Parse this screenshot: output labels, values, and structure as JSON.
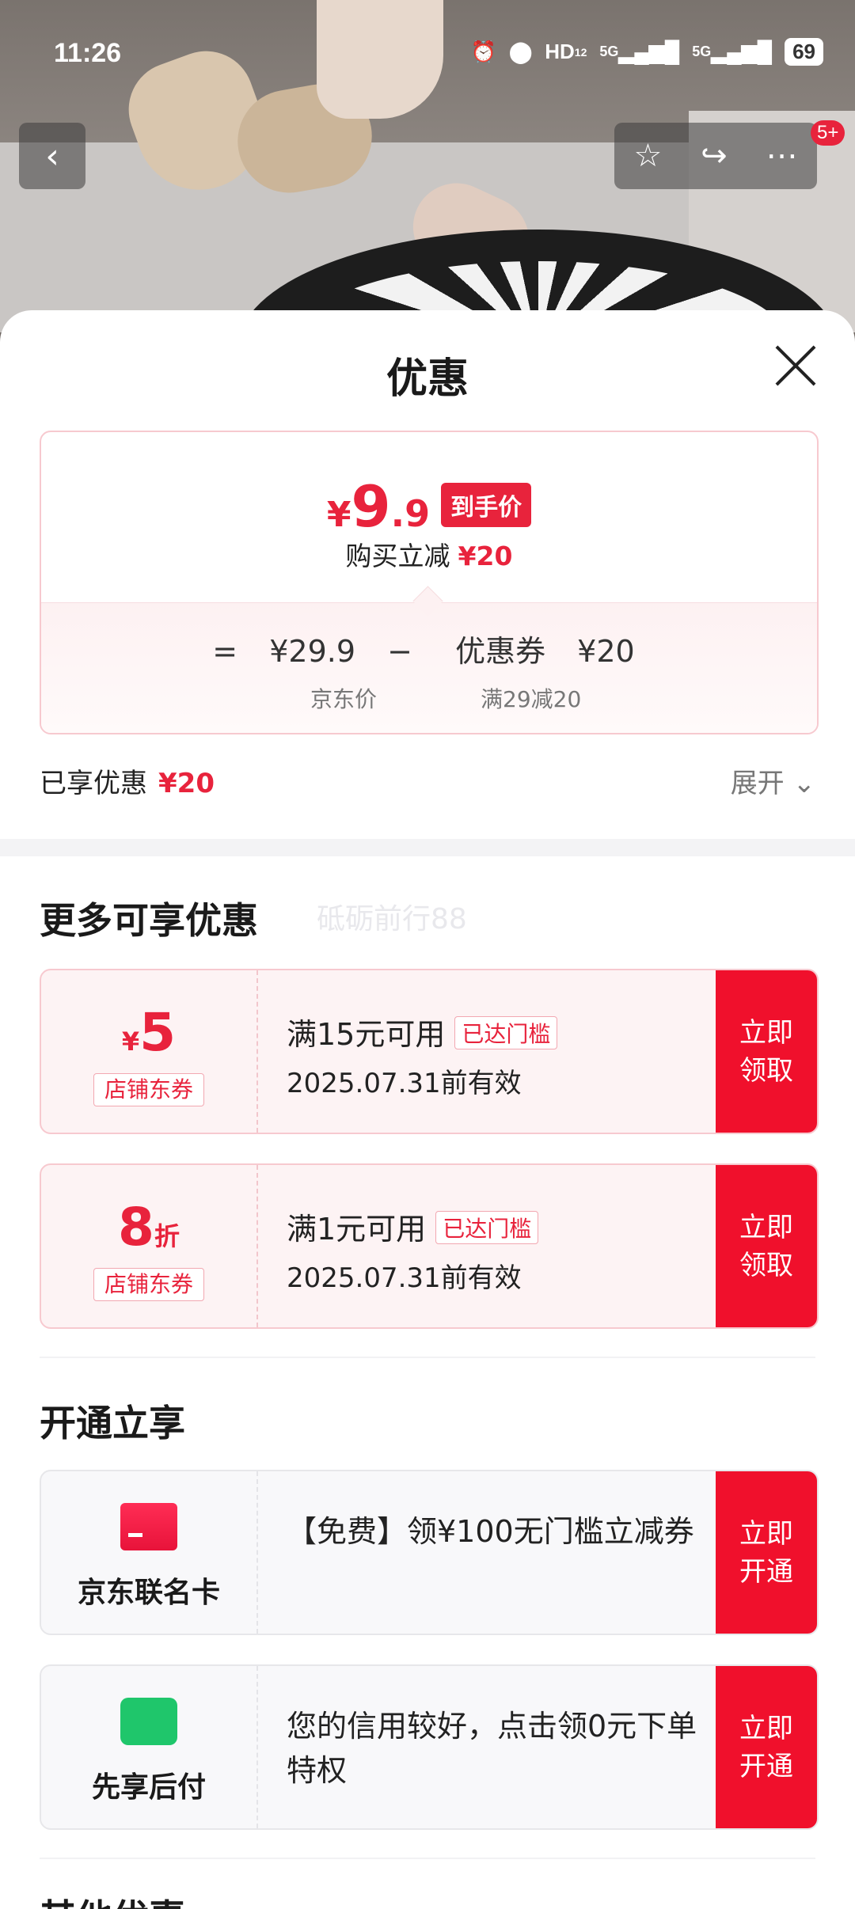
{
  "status_bar": {
    "time": "11:26",
    "network": "HD",
    "network_sup": "1",
    "network_sub": "2",
    "sim1": "5G",
    "sim2": "5G",
    "battery": "69"
  },
  "top_bar": {
    "badge": "5+"
  },
  "sheet": {
    "title": "优惠",
    "price": {
      "yen": "¥",
      "integer": "9",
      "decimal": ".9",
      "tag": "到手价",
      "sub_label": "购买立减",
      "sub_value": "¥20",
      "formula_eq": "=",
      "formula_price": "¥29.9",
      "formula_minus": "−",
      "formula_coupon_label": "优惠券",
      "formula_coupon_value": "¥20",
      "label_price": "京东价",
      "label_coupon": "满29减20"
    },
    "enjoyed": {
      "label": "已享优惠",
      "value": "¥20",
      "expand": "展开"
    },
    "more": {
      "title": "更多可享优惠",
      "watermark": "砥砺前行88",
      "coupons": [
        {
          "value_prefix": "¥",
          "value": "5",
          "value_suffix": "",
          "tag": "店铺东券",
          "condition": "满15元可用",
          "reached": "已达门槛",
          "valid": "2025.07.31前有效",
          "button_line1": "立即",
          "button_line2": "领取"
        },
        {
          "value_prefix": "",
          "value": "8",
          "value_suffix": "折",
          "tag": "店铺东券",
          "condition": "满1元可用",
          "reached": "已达门槛",
          "valid": "2025.07.31前有效",
          "button_line1": "立即",
          "button_line2": "领取"
        }
      ]
    },
    "open": {
      "title": "开通立享",
      "items": [
        {
          "icon": "credit-card-icon",
          "name": "京东联名卡",
          "desc": "【免费】领¥100无门槛立减券",
          "button_line1": "立即",
          "button_line2": "开通"
        },
        {
          "icon": "shopping-bag-icon",
          "name": "先享后付",
          "desc": "您的信用较好，点击领0元下单特权",
          "button_line1": "立即",
          "button_line2": "开通"
        }
      ]
    },
    "other": {
      "title": "其他优惠"
    }
  },
  "colors": {
    "accent": "#e8233c",
    "button": "#f0102c",
    "coupon_bg": "#fdf3f4"
  }
}
